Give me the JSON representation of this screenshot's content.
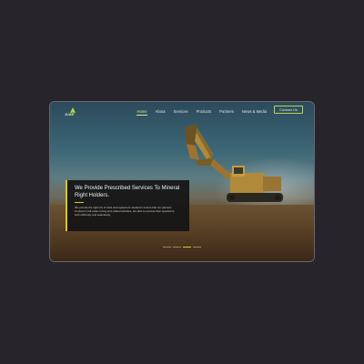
{
  "brand": {
    "logo_text": "JUAL"
  },
  "nav": {
    "items": [
      {
        "label": "Home",
        "active": true
      },
      {
        "label": "About",
        "active": false
      },
      {
        "label": "Services",
        "active": false
      },
      {
        "label": "Products",
        "active": false
      },
      {
        "label": "Partners",
        "active": false
      },
      {
        "label": "News & Media",
        "active": false
      }
    ],
    "contact_label": "Contact Us"
  },
  "hero": {
    "title": "We Provide Prescribed Services To Mineral Right Holders.",
    "text": "We provide the right mix of tools and equipment needed to ensure that our partners involved in full-scale mining and related activities, are able to execute their operations both efficiently and seamlessly."
  },
  "slider": {
    "count": 4,
    "active_index": 2
  },
  "colors": {
    "accent": "#d9c62a",
    "nav_active": "#d9e67a",
    "background": "#27252b",
    "card": "#141416"
  }
}
